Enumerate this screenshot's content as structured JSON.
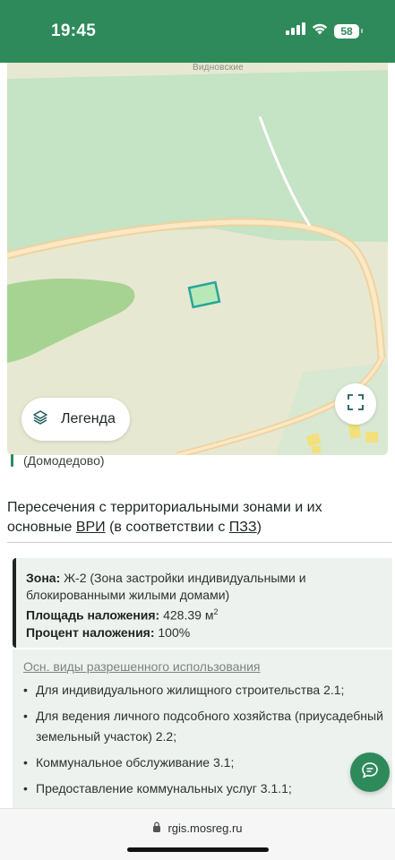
{
  "status_bar": {
    "time": "19:45",
    "battery": "58",
    "icons": [
      "signal-icon",
      "wifi-icon",
      "battery-icon"
    ],
    "background": "#2e8a5b"
  },
  "map": {
    "place_label": "Видновские",
    "legend_label": "Легенда",
    "legend_icon": "layers-icon",
    "fullscreen_icon": "fullscreen-icon",
    "colors": {
      "base": "#e7e8d2",
      "forest": "#c5e3c5",
      "grass": "#a6d391",
      "road_outer": "#f0d2a0",
      "road_inner": "#fbe8c4",
      "parcel_fill": "#b8e8b8",
      "parcel_border": "#2aa59a",
      "buildings": "#f3e07c"
    }
  },
  "location": {
    "text": "(Домодедово)"
  },
  "intersections": {
    "title_part1": "Пересечения с территориальными зонами и их основные ",
    "title_vri": "ВРИ",
    "title_part2": " (в соответствии с ",
    "title_pzz": "ПЗЗ",
    "title_part3": ")"
  },
  "zone": {
    "zone_label": "Зона:",
    "zone_value": " Ж-2 (Зона застройки индивидуальными и блокированными жилыми домами)",
    "area_label": "Площадь наложения:",
    "area_value": " 428.39 м",
    "area_unit_sup": "2",
    "percent_label": "Процент наложения:",
    "percent_value": " 100%"
  },
  "uses": {
    "title": "Осн. виды разрешенного использования",
    "items": [
      "Для индивидуального жилищного строительства 2.1;",
      "Для ведения личного подсобного хозяйства (приусадебный земельный участок) 2.2;",
      "Коммунальное обслуживание 3.1;",
      "Предоставление коммунальных услуг 3.1.1;"
    ]
  },
  "chat": {
    "icon": "chat-icon"
  },
  "browser": {
    "url": "rgis.mosreg.ru",
    "lock_icon": "lock-icon"
  }
}
